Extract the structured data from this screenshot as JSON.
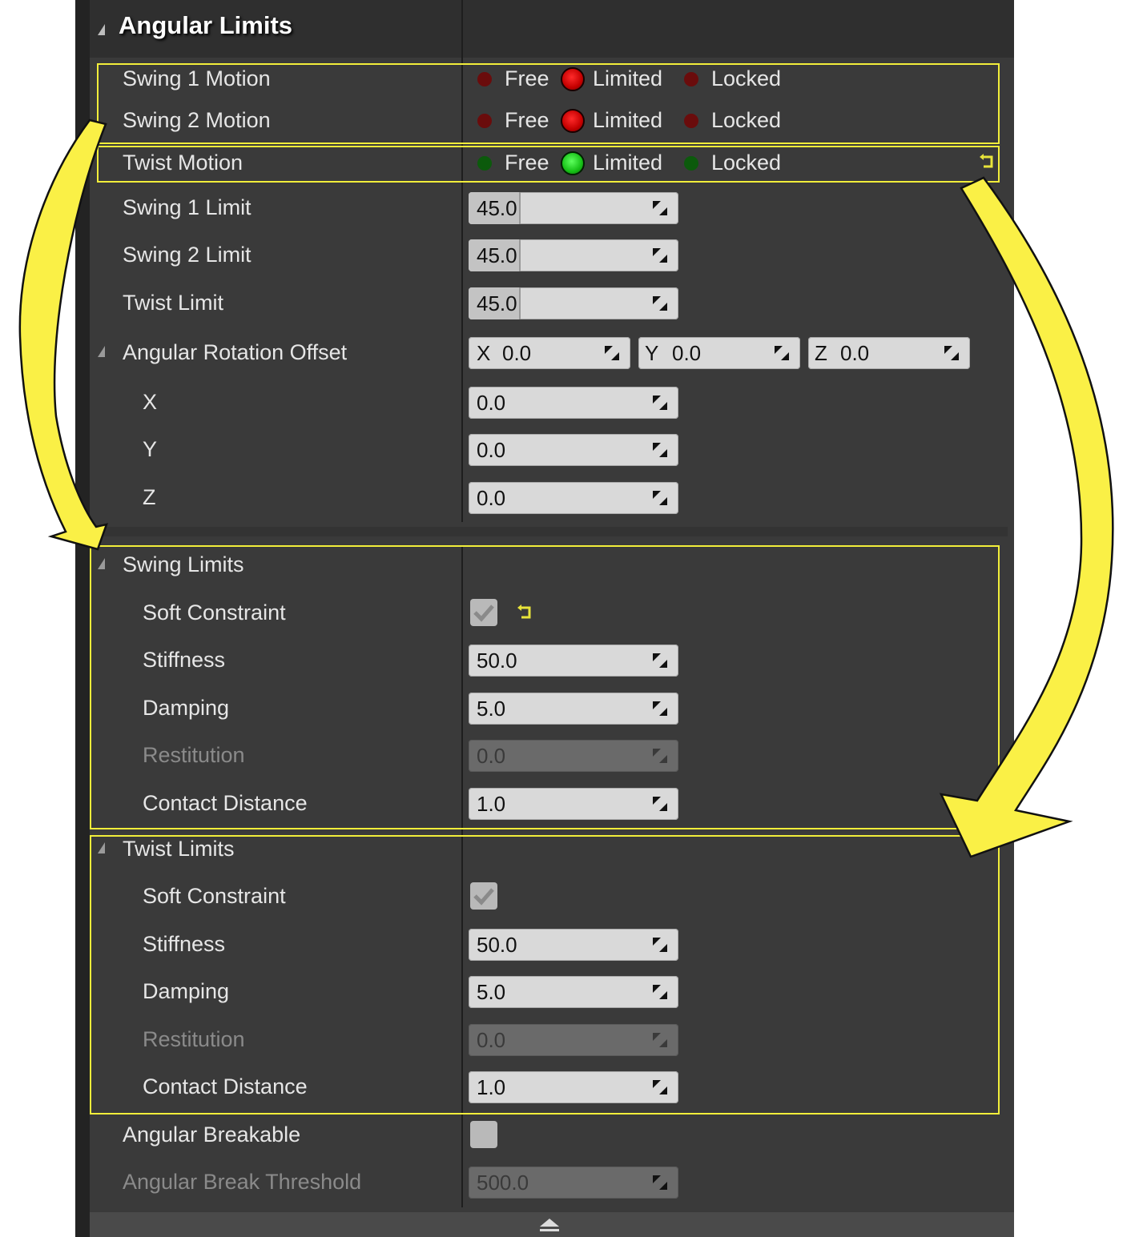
{
  "header": {
    "title": "Angular Limits"
  },
  "motion": {
    "swing1": {
      "label": "Swing 1 Motion",
      "options": [
        "Free",
        "Limited",
        "Locked"
      ],
      "selected": "Limited"
    },
    "swing2": {
      "label": "Swing 2 Motion",
      "options": [
        "Free",
        "Limited",
        "Locked"
      ],
      "selected": "Limited"
    },
    "twist": {
      "label": "Twist Motion",
      "options": [
        "Free",
        "Limited",
        "Locked"
      ],
      "selected": "Limited"
    }
  },
  "limits": {
    "swing1": {
      "label": "Swing 1 Limit",
      "value": "45.0"
    },
    "swing2": {
      "label": "Swing 2 Limit",
      "value": "45.0"
    },
    "twist": {
      "label": "Twist Limit",
      "value": "45.0"
    }
  },
  "rotation_offset": {
    "label": "Angular Rotation Offset",
    "x_tag": "X",
    "x_value": "0.0",
    "y_tag": "Y",
    "y_value": "0.0",
    "z_tag": "Z",
    "z_value": "0.0",
    "x": {
      "label": "X",
      "value": "0.0"
    },
    "y": {
      "label": "Y",
      "value": "0.0"
    },
    "z": {
      "label": "Z",
      "value": "0.0"
    }
  },
  "swing_limits": {
    "title": "Swing Limits",
    "soft_constraint": {
      "label": "Soft Constraint",
      "checked": true
    },
    "stiffness": {
      "label": "Stiffness",
      "value": "50.0"
    },
    "damping": {
      "label": "Damping",
      "value": "5.0"
    },
    "restitution": {
      "label": "Restitution",
      "value": "0.0"
    },
    "contact_distance": {
      "label": "Contact Distance",
      "value": "1.0"
    }
  },
  "twist_limits": {
    "title": "Twist Limits",
    "soft_constraint": {
      "label": "Soft Constraint",
      "checked": true
    },
    "stiffness": {
      "label": "Stiffness",
      "value": "50.0"
    },
    "damping": {
      "label": "Damping",
      "value": "5.0"
    },
    "restitution": {
      "label": "Restitution",
      "value": "0.0"
    },
    "contact_distance": {
      "label": "Contact Distance",
      "value": "1.0"
    }
  },
  "breakable": {
    "label": "Angular Breakable",
    "checked": false,
    "threshold_label": "Angular Break Threshold",
    "threshold_value": "500.0"
  },
  "colors": {
    "highlight": "#f2ee3a",
    "arrow": "#faf046",
    "twist_radio": "#16c016",
    "swing_radio": "#c40000"
  }
}
